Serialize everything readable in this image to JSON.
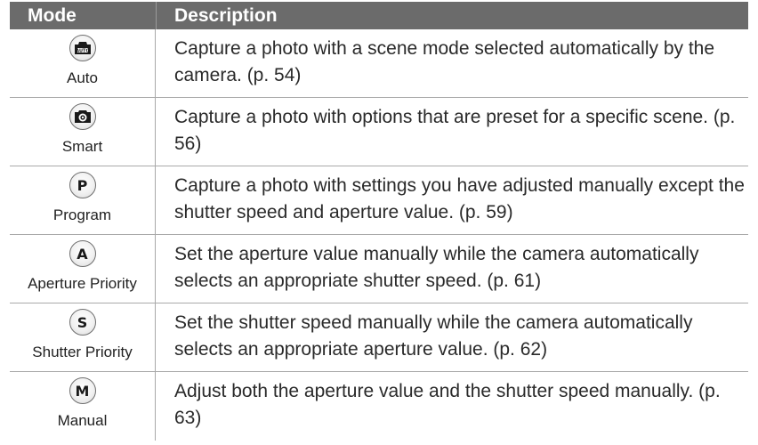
{
  "table": {
    "headers": {
      "mode": "Mode",
      "description": "Description"
    },
    "rows": [
      {
        "icon_name": "auto-mode-icon",
        "icon_text": "",
        "mode": "Auto",
        "description": "Capture a photo with a scene mode selected automatically by the camera. (p. 54)"
      },
      {
        "icon_name": "smart-mode-icon",
        "icon_text": "",
        "mode": "Smart",
        "description": "Capture a photo with options that are preset for a specific scene. (p. 56)"
      },
      {
        "icon_name": "program-mode-icon",
        "icon_text": "P",
        "mode": "Program",
        "description": "Capture a photo with settings you have adjusted manually except the shutter speed and aperture value. (p. 59)"
      },
      {
        "icon_name": "aperture-priority-mode-icon",
        "icon_text": "A",
        "mode": "Aperture Priority",
        "description": "Set the aperture value manually while the camera automatically selects an appropriate shutter speed. (p. 61)"
      },
      {
        "icon_name": "shutter-priority-mode-icon",
        "icon_text": "S",
        "mode": "Shutter Priority",
        "description": "Set the shutter speed manually while the camera automatically selects an appropriate aperture value. (p. 62)"
      },
      {
        "icon_name": "manual-mode-icon",
        "icon_text": "M",
        "mode": "Manual",
        "description": "Adjust both the aperture value and the shutter speed manually. (p. 63)"
      }
    ]
  },
  "colors": {
    "header_background": "#6b6b6b",
    "header_text": "#ffffff",
    "row_divider": "#a9a9a9"
  }
}
